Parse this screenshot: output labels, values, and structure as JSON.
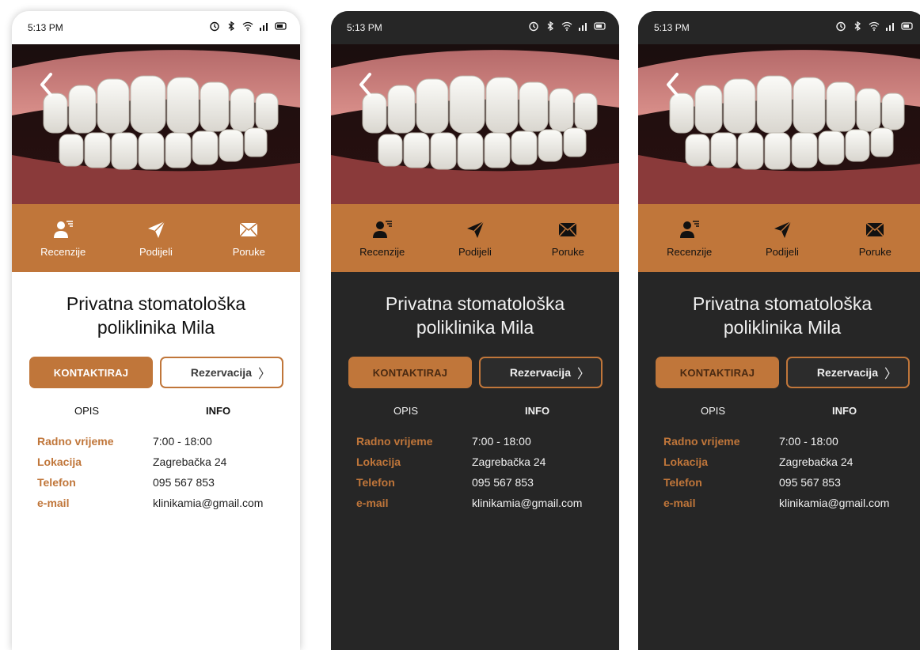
{
  "status_bar": {
    "time": "5:13 PM"
  },
  "actions": [
    {
      "label": "Recenzije",
      "icon": "user-reviews-icon"
    },
    {
      "label": "Podijeli",
      "icon": "paper-plane-icon"
    },
    {
      "label": "Poruke",
      "icon": "envelope-icon"
    }
  ],
  "clinic": {
    "title_line1": "Privatna stomatološka",
    "title_line2": "poliklinika Mila"
  },
  "buttons": {
    "contact": "KONTAKTIRAJ",
    "reserve": "Rezervacija",
    "reserve_chevron": "〉"
  },
  "tabs": {
    "opis": "OPIS",
    "info": "INFO"
  },
  "info": [
    {
      "label": "Radno vrijeme",
      "value": "7:00 - 18:00"
    },
    {
      "label": "Lokacija",
      "value": "Zagrebačka 24"
    },
    {
      "label": "Telefon",
      "value": "095 567 853"
    },
    {
      "label": "e-mail",
      "value": "klinikamia@gmail.com"
    }
  ],
  "colors": {
    "accent": "#c0763a",
    "dark_bg": "#262626",
    "light_bg": "#ffffff"
  }
}
